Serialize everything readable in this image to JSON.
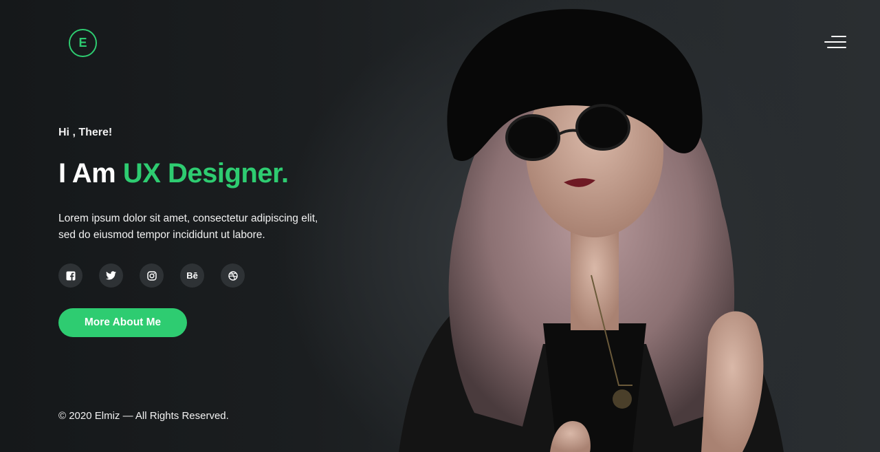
{
  "brand": {
    "logo_letter": "E",
    "accent_color": "#2ecc71"
  },
  "hero": {
    "greeting": "Hi , There!",
    "headline_prefix": "I Am",
    "headline_accent": "UX Designer.",
    "description": "Lorem ipsum dolor sit amet, consectetur adipiscing elit, sed do eiusmod tempor incididunt ut labore.",
    "cta_label": "More About Me"
  },
  "socials": [
    {
      "icon": "facebook-icon"
    },
    {
      "icon": "twitter-icon"
    },
    {
      "icon": "instagram-icon"
    },
    {
      "icon": "behance-icon",
      "label": "Bē"
    },
    {
      "icon": "dribbble-icon"
    }
  ],
  "footer": {
    "copyright": "© 2020 Elmiz — All Rights Reserved."
  }
}
